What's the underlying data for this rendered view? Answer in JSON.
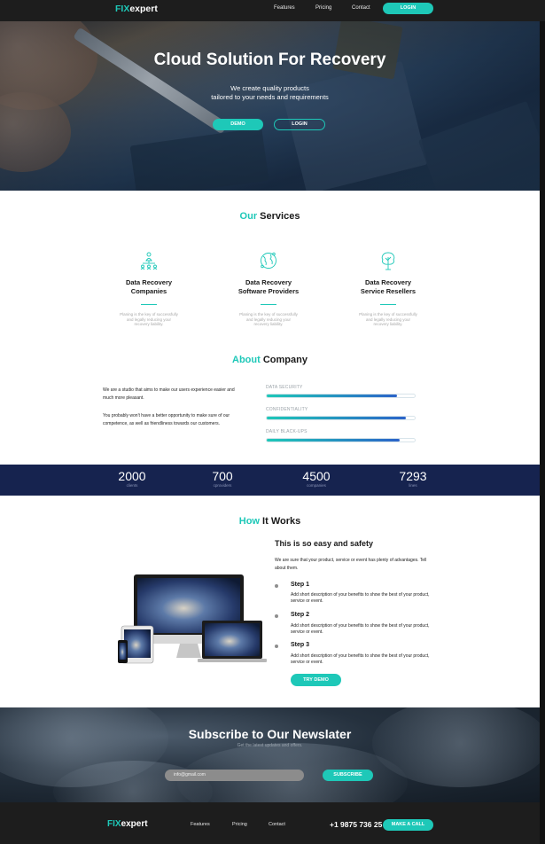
{
  "nav": {
    "logo_fix": "FIX",
    "logo_expert": "expert",
    "links": [
      "Features",
      "Pricing",
      "Contact"
    ],
    "login": "LOGIN"
  },
  "hero": {
    "title": "Cloud Solution For Recovery",
    "subtitle_line1": "We create quality products",
    "subtitle_line2": "tailored to your needs and requirements",
    "demo": "DEMO",
    "login": "LOGIN"
  },
  "services": {
    "title_accent": "Our",
    "title_rest": "Services",
    "items": [
      {
        "icon": "network-people-icon",
        "title": "Data Recovery\nCompanies",
        "desc": "Planing is the key of successfully\nand legally reducing your\nrecovery liability."
      },
      {
        "icon": "globe-icon",
        "title": "Data Recovery\nSoftware Providers",
        "desc": "Planing is the key of successfully\nand legally reducing your\nrecovery liability."
      },
      {
        "icon": "tree-icon",
        "title": "Data Recovery\nService Resellers",
        "desc": "Planing is the key of successfully\nand legally reducing your\nrecovery liability."
      }
    ]
  },
  "about": {
    "title_accent": "About",
    "title_rest": "Company",
    "p1": "We are a studio that aims to make our users experience easier and much more pleasant.",
    "p2": "You probably won't have a better opportunity to make sure of our competence, as well as friendliness towards our customers.",
    "bars": [
      {
        "label": "DATA SECURITY",
        "value": 0.88
      },
      {
        "label": "CONFIDENTIALITY",
        "value": 0.94
      },
      {
        "label": "DAILY BLACK-UPS",
        "value": 0.9
      }
    ]
  },
  "stats": [
    {
      "num": "2000",
      "label": "clients"
    },
    {
      "num": "700",
      "label": "cproviders"
    },
    {
      "num": "4500",
      "label": "companies"
    },
    {
      "num": "7293",
      "label": "lines"
    }
  ],
  "how": {
    "title_accent": "How",
    "title_rest": "It Works",
    "heading": "This is so easy and safety",
    "intro": "We are sure that your product, service or event has plenty of advantages. Tell about them.",
    "steps": [
      {
        "title": "Step 1",
        "desc": "Add short description of your benefits to show the best of your product, service or event."
      },
      {
        "title": "Step 2",
        "desc": "Add short description of your benefits to show the best of your product, service or event."
      },
      {
        "title": "Step 3",
        "desc": "Add short description of your benefits to show the best of your product, service or event."
      }
    ],
    "cta": "TRY DEMO"
  },
  "newsletter": {
    "title": "Subscribe to Our Newslater",
    "subtitle": "Get the latest updates and offers.",
    "email_value": "info@gmail.com",
    "subscribe": "SUBSCRIBE"
  },
  "footer": {
    "logo_fix": "FIX",
    "logo_expert": "expert",
    "links": [
      "Features",
      "Pricing",
      "Contact"
    ],
    "phone": "+1 9875 736 25",
    "call": "MAKE A CALL"
  },
  "colors": {
    "accent": "#1ec8b8",
    "navy": "#16234f",
    "dark": "#1d1d1d"
  }
}
